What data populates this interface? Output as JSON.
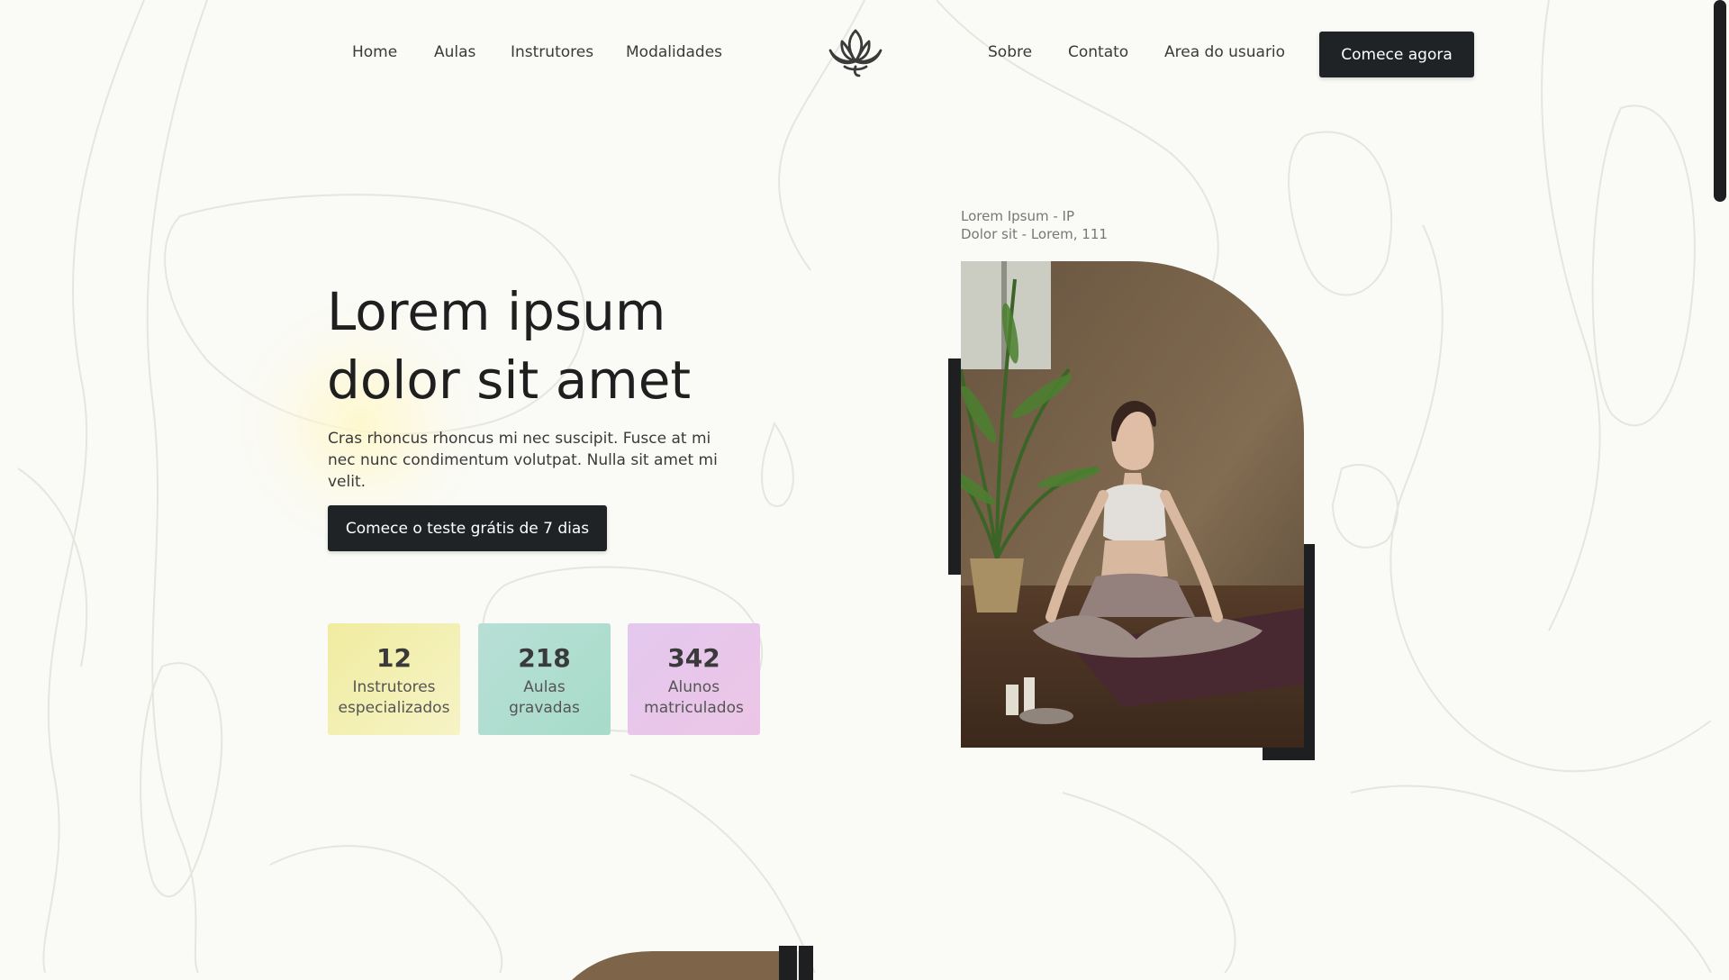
{
  "nav": {
    "left": [
      "Home",
      "Aulas",
      "Instrutores",
      "Modalidades"
    ],
    "right": [
      "Sobre",
      "Contato",
      "Area do usuario"
    ],
    "cta": "Comece agora",
    "logo_icon": "lotus-icon"
  },
  "hero": {
    "title_line1": "Lorem ipsum",
    "title_line2": "dolor sit amet",
    "text": "Cras rhoncus rhoncus mi nec suscipit. Fusce at mi nec nunc condimentum volutpat. Nulla sit amet mi velit.",
    "cta": "Comece o teste grátis de 7 dias"
  },
  "stats": [
    {
      "number": "12",
      "label_line1": "Instrutores",
      "label_line2": "especializados",
      "color": "#f2eeb0"
    },
    {
      "number": "218",
      "label_line1": "Aulas",
      "label_line2": "gravadas",
      "color": "#b3dfd2"
    },
    {
      "number": "342",
      "label_line1": "Alunos",
      "label_line2": "matriculados",
      "color": "#e8c8ec"
    }
  ],
  "location": {
    "line1": "Lorem Ipsum - IP",
    "line2": "Dolor sit - Lorem, 111"
  },
  "colors": {
    "background": "#fafaf7",
    "button": "#1f2326",
    "text": "#1f1f1f"
  }
}
